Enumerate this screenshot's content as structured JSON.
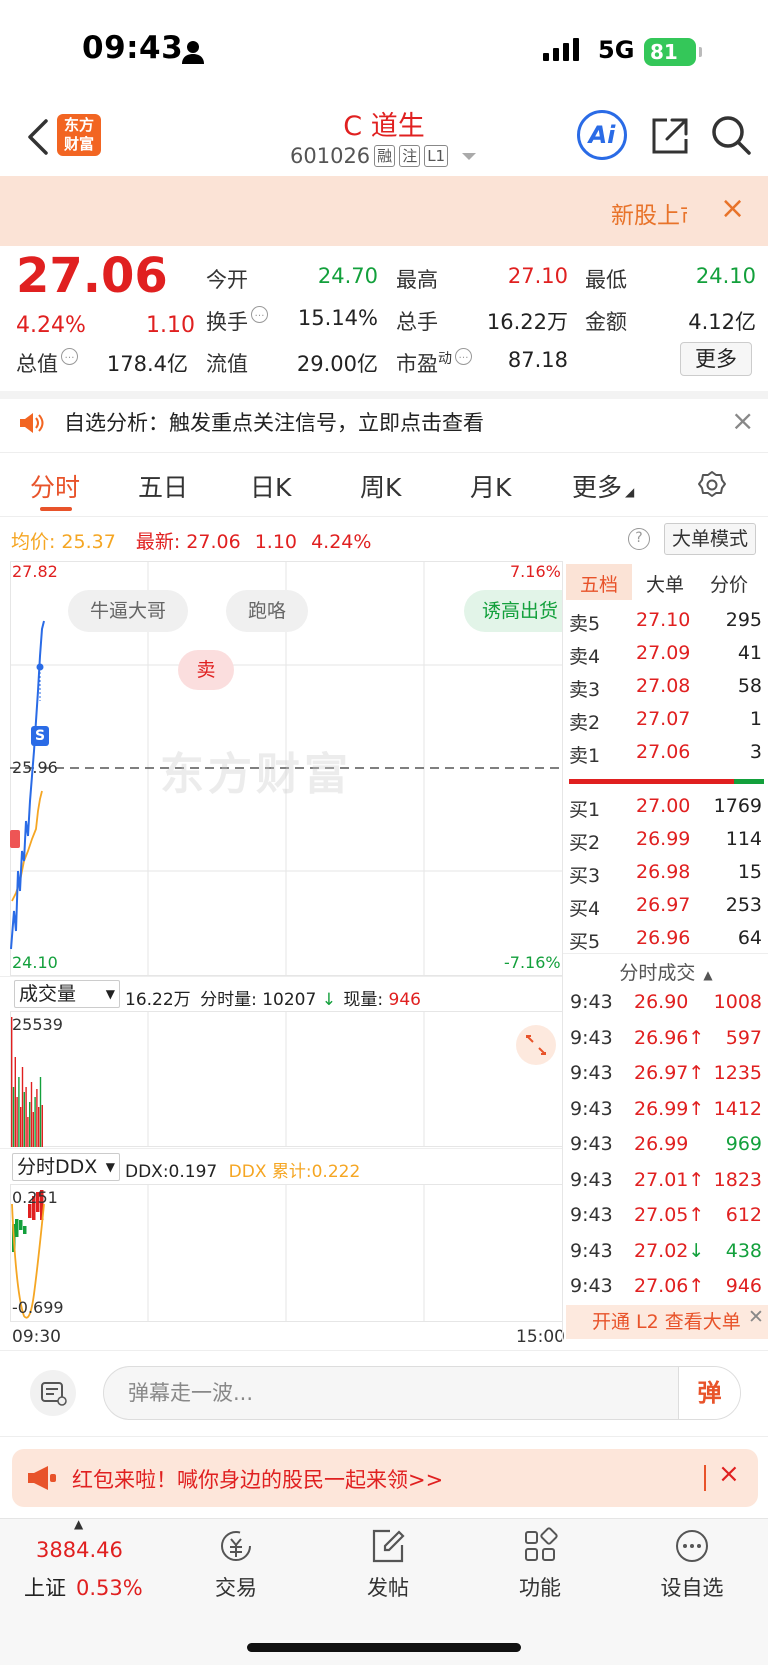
{
  "status_bar": {
    "time": "09:43",
    "network": "5G",
    "battery": "81"
  },
  "header": {
    "stock_name": "C 道生",
    "stock_code": "601026",
    "tags": [
      "融",
      "注",
      "L1"
    ],
    "logo_text_line1": "东方",
    "logo_text_line2": "财富",
    "ai_label": "Ai"
  },
  "banner": {
    "text": "新股上市",
    "close": "×"
  },
  "quote": {
    "price": "27.06",
    "change_pct": "4.24%",
    "change_abs": "1.10",
    "open_label": "今开",
    "open": "24.70",
    "high_label": "最高",
    "high": "27.10",
    "low_label": "最低",
    "low": "24.10",
    "turnover_label": "换手",
    "turnover": "15.14%",
    "volume_label": "总手",
    "volume": "16.22万",
    "amount_label": "金额",
    "amount": "4.12亿",
    "mktcap_label": "总值",
    "mktcap": "178.4亿",
    "float_label": "流值",
    "float": "29.00亿",
    "pe_label": "市盈",
    "pe_sup": "动",
    "pe": "87.18",
    "more": "更多"
  },
  "analysis": {
    "text": "自选分析：触发重点关注信号，立即点击查看",
    "close": "×"
  },
  "tabs": [
    "分时",
    "五日",
    "日K",
    "周K",
    "月K",
    "更多"
  ],
  "info_line": {
    "avg_label": "均价:",
    "avg": "25.37",
    "latest_label": "最新:",
    "latest": "27.06",
    "chg": "1.10",
    "pct": "4.24%",
    "help": "?",
    "mode_button": "大单模式"
  },
  "chart": {
    "price_high": "27.82",
    "price_low": "24.10",
    "pct_high": "7.16%",
    "pct_low": "-7.16%",
    "prev_close": "25.96",
    "watermark": "东方财富",
    "pills": [
      "牛逼大哥",
      "跑咯",
      "诱高出货"
    ],
    "sell_bubble": "卖",
    "s_marker": "S",
    "volume_select": "成交量",
    "volume_total": "16.22万",
    "minute_vol_label": "分时量:",
    "minute_vol": "10207",
    "arrow": "↓",
    "cur_vol_label": "现量:",
    "cur_vol": "946",
    "volume_max": "25539",
    "ddx_select": "分时DDX",
    "ddx_label": "DDX:0.197",
    "ddx_cum": "DDX 累计:0.222",
    "ddx_high": "0.251",
    "ddx_low": "-0.699",
    "time_start": "09:30",
    "time_end": "15:00",
    "colors": {
      "price_line": "#2a6be6",
      "avg_line": "#f5a623",
      "up": "#e02020",
      "down": "#13a03c"
    }
  },
  "order_book": {
    "tabs": [
      "五档",
      "大单",
      "分价"
    ],
    "asks": [
      {
        "label": "卖5",
        "price": "27.10",
        "vol": "295"
      },
      {
        "label": "卖4",
        "price": "27.09",
        "vol": "41"
      },
      {
        "label": "卖3",
        "price": "27.08",
        "vol": "58"
      },
      {
        "label": "卖2",
        "price": "27.07",
        "vol": "1"
      },
      {
        "label": "卖1",
        "price": "27.06",
        "vol": "3"
      }
    ],
    "bids": [
      {
        "label": "买1",
        "price": "27.00",
        "vol": "1769"
      },
      {
        "label": "买2",
        "price": "26.99",
        "vol": "114"
      },
      {
        "label": "买3",
        "price": "26.98",
        "vol": "15"
      },
      {
        "label": "买4",
        "price": "26.97",
        "vol": "253"
      },
      {
        "label": "买5",
        "price": "26.96",
        "vol": "64"
      }
    ],
    "trades_title": "分时成交",
    "trades": [
      {
        "time": "9:43",
        "price": "26.90",
        "arrow": "",
        "vol": "1008",
        "dir": "up"
      },
      {
        "time": "9:43",
        "price": "26.96",
        "arrow": "↑",
        "vol": "597",
        "dir": "up"
      },
      {
        "time": "9:43",
        "price": "26.97",
        "arrow": "↑",
        "vol": "1235",
        "dir": "up"
      },
      {
        "time": "9:43",
        "price": "26.99",
        "arrow": "↑",
        "vol": "1412",
        "dir": "up"
      },
      {
        "time": "9:43",
        "price": "26.99",
        "arrow": "",
        "vol": "969",
        "dir": "down"
      },
      {
        "time": "9:43",
        "price": "27.01",
        "arrow": "↑",
        "vol": "1823",
        "dir": "up"
      },
      {
        "time": "9:43",
        "price": "27.05",
        "arrow": "↑",
        "vol": "612",
        "dir": "up"
      },
      {
        "time": "9:43",
        "price": "27.02",
        "arrow": "↓",
        "vol": "438",
        "dir": "down"
      },
      {
        "time": "9:43",
        "price": "27.06",
        "arrow": "↑",
        "vol": "946",
        "dir": "up"
      }
    ],
    "l2_promo": "开通 L2 查看大单"
  },
  "comment": {
    "placeholder": "弹幕走一波...",
    "danmu_button": "弹"
  },
  "red_packet": {
    "text": "红包来啦！喊你身边的股民一起来领>>",
    "close": "×"
  },
  "bottom_nav": {
    "index_value": "3884.46",
    "index_name": "上证",
    "index_pct": "0.53%",
    "items": [
      {
        "label": "交易",
        "icon": "yuan-exchange-icon"
      },
      {
        "label": "发帖",
        "icon": "edit-post-icon"
      },
      {
        "label": "功能",
        "icon": "grid-apps-icon"
      },
      {
        "label": "设自选",
        "icon": "more-dots-icon"
      }
    ]
  }
}
